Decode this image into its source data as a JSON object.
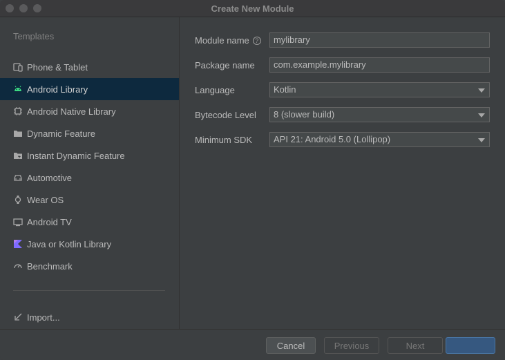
{
  "window": {
    "title": "Create New Module"
  },
  "sidebar": {
    "header": "Templates",
    "items": [
      {
        "label": "Phone & Tablet",
        "icon": "phone-tablet-icon",
        "selected": false
      },
      {
        "label": "Android Library",
        "icon": "android-icon",
        "selected": true
      },
      {
        "label": "Android Native Library",
        "icon": "native-library-icon",
        "selected": false
      },
      {
        "label": "Dynamic Feature",
        "icon": "folder-icon",
        "selected": false
      },
      {
        "label": "Instant Dynamic Feature",
        "icon": "folder-lightning-icon",
        "selected": false
      },
      {
        "label": "Automotive",
        "icon": "car-icon",
        "selected": false
      },
      {
        "label": "Wear OS",
        "icon": "watch-icon",
        "selected": false
      },
      {
        "label": "Android TV",
        "icon": "tv-icon",
        "selected": false
      },
      {
        "label": "Java or Kotlin Library",
        "icon": "kotlin-icon",
        "selected": false
      },
      {
        "label": "Benchmark",
        "icon": "gauge-icon",
        "selected": false
      }
    ],
    "import": {
      "label": "Import...",
      "icon": "import-icon"
    }
  },
  "form": {
    "module_name": {
      "label": "Module name",
      "value": "mylibrary"
    },
    "package_name": {
      "label": "Package name",
      "value": "com.example.mylibrary"
    },
    "language": {
      "label": "Language",
      "value": "Kotlin"
    },
    "bytecode_level": {
      "label": "Bytecode Level",
      "value": "8 (slower build)"
    },
    "minimum_sdk": {
      "label": "Minimum SDK",
      "value": "API 21: Android 5.0 (Lollipop)"
    }
  },
  "footer": {
    "cancel": "Cancel",
    "previous": "Previous",
    "next": "Next",
    "finish": ""
  },
  "colors": {
    "background": "#3c3f41",
    "selection": "#0d293e",
    "primary_button": "#365880"
  }
}
